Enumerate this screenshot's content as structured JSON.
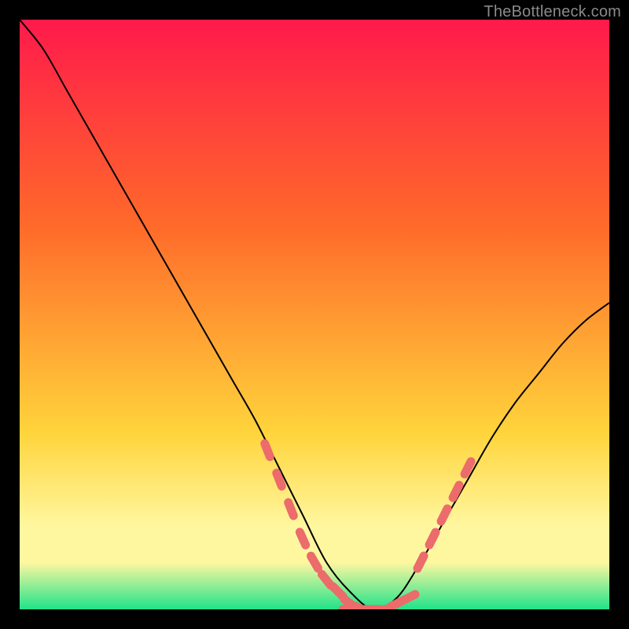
{
  "watermark": "TheBottleneck.com",
  "colors": {
    "frame": "#000000",
    "gradient_top": "#ff1a4b",
    "gradient_mid1": "#ff6a2a",
    "gradient_mid2": "#ffd43b",
    "gradient_band": "#fff7a0",
    "gradient_bottom": "#21e38a",
    "curve": "#000000",
    "marker": "#ec6b6b",
    "watermark": "#8a8a8a"
  },
  "chart_data": {
    "type": "line",
    "title": "",
    "xlabel": "",
    "ylabel": "",
    "xlim": [
      0,
      100
    ],
    "ylim": [
      0,
      100
    ],
    "series": [
      {
        "name": "bottleneck-curve",
        "x": [
          0,
          4,
          8,
          12,
          16,
          20,
          24,
          28,
          32,
          36,
          40,
          44,
          48,
          52,
          56,
          60,
          64,
          68,
          72,
          76,
          80,
          84,
          88,
          92,
          96,
          100
        ],
        "values": [
          100,
          95,
          88,
          81,
          74,
          67,
          60,
          53,
          46,
          39,
          32,
          24,
          16,
          8,
          3,
          0,
          2,
          8,
          15,
          22,
          29,
          35,
          40,
          45,
          49,
          52
        ]
      },
      {
        "name": "highlight-left",
        "x": [
          42,
          44,
          46,
          48,
          50,
          52,
          54,
          56,
          58
        ],
        "values": [
          27,
          22,
          17,
          12,
          8,
          5,
          3,
          1,
          0
        ]
      },
      {
        "name": "highlight-bottom",
        "x": [
          56,
          58,
          60,
          62,
          64,
          66
        ],
        "values": [
          0,
          0,
          0,
          0,
          1,
          2
        ]
      },
      {
        "name": "highlight-right",
        "x": [
          68,
          70,
          72,
          74,
          76
        ],
        "values": [
          8,
          12,
          16,
          20,
          24
        ]
      }
    ],
    "gradient_stops": [
      {
        "pos": 0.0,
        "color": "#ff1a4b"
      },
      {
        "pos": 0.35,
        "color": "#ff6a2a"
      },
      {
        "pos": 0.7,
        "color": "#ffd43b"
      },
      {
        "pos": 0.86,
        "color": "#fff7a0"
      },
      {
        "pos": 0.92,
        "color": "#fff7a0"
      },
      {
        "pos": 1.0,
        "color": "#21e38a"
      }
    ]
  }
}
